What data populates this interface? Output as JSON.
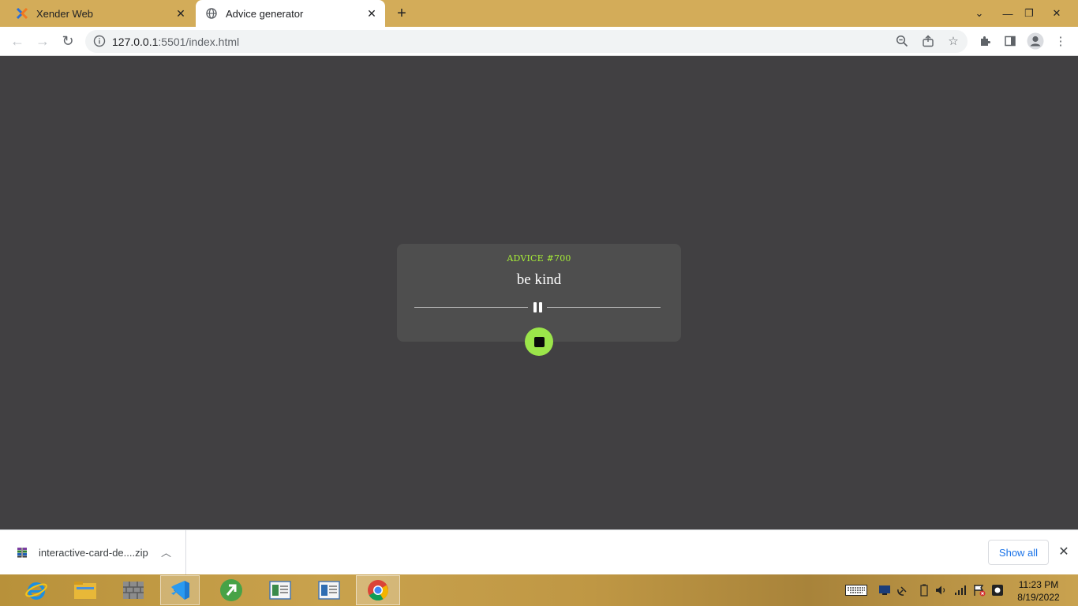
{
  "browser": {
    "tabs": [
      {
        "title": "Xender Web",
        "active": false
      },
      {
        "title": "Advice generator",
        "active": true
      }
    ],
    "url_host": "127.0.0.1",
    "url_path": ":5501/index.html"
  },
  "page": {
    "advice_label": "ADVICE #700",
    "advice_text": "be kind",
    "accent_color": "#a7ee37",
    "button_color": "#9be54a",
    "card_color": "#4e4e4e",
    "background_color": "#414042"
  },
  "download_bar": {
    "file_name": "interactive-card-de....zip",
    "show_all_label": "Show all"
  },
  "taskbar": {
    "apps": [
      "internet-explorer",
      "file-explorer",
      "firewall",
      "vs-code",
      "git-app",
      "notepad",
      "wordpad",
      "chrome"
    ],
    "active_app": "vs-code",
    "time": "11:23 PM",
    "date": "8/19/2022"
  }
}
